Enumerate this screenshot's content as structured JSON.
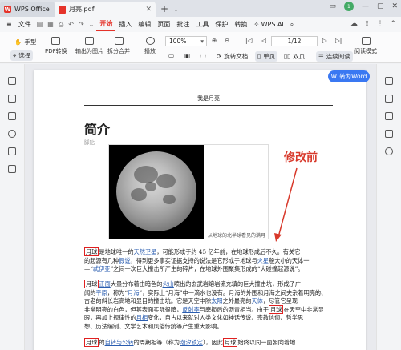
{
  "titlebar": {
    "tabs": [
      {
        "label": "WPS Office"
      },
      {
        "label": "月亮.pdf"
      }
    ],
    "badge": "1"
  },
  "menu": {
    "file_label": "文件",
    "items": [
      "开始",
      "插入",
      "编辑",
      "页面",
      "批注",
      "工具",
      "保护",
      "转换"
    ],
    "active": "开始",
    "ai_label": "WPS AI"
  },
  "ribbon": {
    "hand_label": "手型",
    "select_label": "选择",
    "pdf_convert_label": "PDF转换",
    "export_image_label": "输出为图片",
    "split_merge_label": "拆分合并",
    "play_label": "播放",
    "zoom_value": "100%",
    "page_value": "1/12",
    "rotate_label": "旋转文档",
    "single_page_label": "单页",
    "double_page_label": "双页",
    "continuous_label": "连续阅读",
    "read_mode_label": "阅读模式"
  },
  "convert_word_label": "转为Word",
  "document": {
    "header": "我是月亮",
    "title": "简介",
    "subtitle": "脚贴",
    "caption": "从地球的北半球看见的满月",
    "annotation": "修改前",
    "para1_line1_pre": "月球",
    "para1_line1_a": "是地球唯一的",
    "para1_line1_link": "天然卫星",
    "para1_line1_b": "，可能形成于约 45 亿年前，在地球形成后不久。有关它",
    "para1_line2_a": "的起源有几种",
    "para1_line2_link": "假说",
    "para1_line2_b": "，得到更多事实证据支持的说法是它形成于地球与",
    "para1_line2_link2": "火星",
    "para1_line2_c": "般大小的天体一",
    "para1_line3_a": "—“",
    "para1_line3_link": "忒伊亚",
    "para1_line3_b": "”之间一次巨大撞击所产生的碎片，在地球外围聚集形成的“大碰撞起源说”。",
    "para2_line1_box": "月球",
    "para2_line1_a": "正面",
    "para2_line1_b": "大量分布着由暗色的",
    "para2_line1_link": "火山",
    "para2_line1_c": "喷出的玄武岩熔岩流充填的巨大撞击坑，形成了广",
    "para2_line2_a": "阔的",
    "para2_line2_link": "平原",
    "para2_line2_b": "，称为“",
    "para2_line2_link2": "月海",
    "para2_line2_c": "”，实际上“月海”中一滴水也没有。月海的外围和月海之间夹杂着明亮的、",
    "para2_line3": "古老的斜长岩高地和显目的撞击坑。它是天空中除",
    "para2_line3_link": "太阳",
    "para2_line3_b": "之外最亮的",
    "para2_line3_link2": "天体",
    "para2_line3_c": "，尽管它呈现",
    "para2_line4_a": "非常明亮的白色，但其表面实际很暗，",
    "para2_line4_link": "反射率",
    "para2_line4_b": "与磨损后的沥青相当。由于",
    "para2_line4_box": "月球",
    "para2_line4_c": "在天空中非常显",
    "para2_line5_a": "眼，再加上规律性的",
    "para2_line5_link": "月相",
    "para2_line5_b": "变化，自古以来就对人类文化如神话传说、宗教信仰、哲学思",
    "para2_line6": "想、历法编制、文学艺术和风俗传统等产生重大影响。",
    "para3_box": "月球",
    "para3_a": "的",
    "para3_link": "自转与公转",
    "para3_b": "的周期相等（称为",
    "para3_link2": "潮汐锁定",
    "para3_c": "），因此",
    "para3_box2": "月球",
    "para3_d": "始终以同一面朝向着地"
  }
}
